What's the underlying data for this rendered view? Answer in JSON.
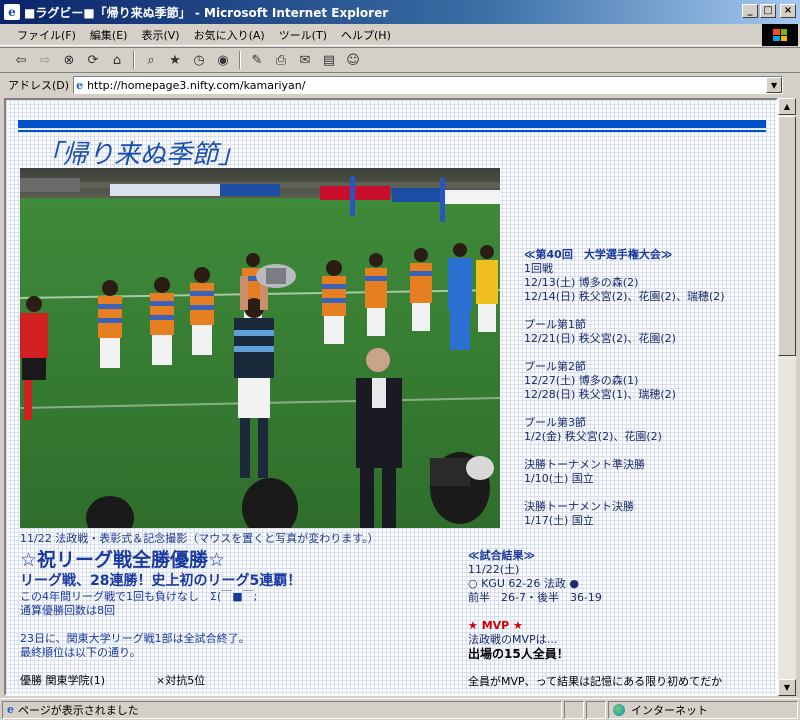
{
  "window": {
    "title": "■ラグビー■「帰り来ぬ季節」 - Microsoft Internet Explorer",
    "buttons": [
      "_",
      "□",
      "×"
    ]
  },
  "menu": [
    "ファイル(F)",
    "編集(E)",
    "表示(V)",
    "お気に入り(A)",
    "ツール(T)",
    "ヘルプ(H)"
  ],
  "toolbar_icons": [
    "back-icon",
    "forward-icon",
    "stop-icon",
    "refresh-icon",
    "home-icon",
    "search-icon",
    "favorites-icon",
    "history-icon",
    "media-icon",
    "edit-icon",
    "print-icon",
    "mail-icon",
    "discuss-icon",
    "messenger-icon"
  ],
  "address": {
    "label": "アドレス(D)",
    "url": "http://homepage3.nifty.com/kamariyan/"
  },
  "page": {
    "title": "「帰り来ぬ季節」",
    "photo_caption": "11/22 法政戦・表彰式＆記念撮影（マウスを置くと写真が変わります。）",
    "schedule": {
      "heading": "≪第40回　大学選手権大会≫",
      "lines": [
        "1回戦",
        "12/13(土) 博多の森(2)",
        "12/14(日) 秩父宮(2)、花園(2)、瑞穂(2)",
        "",
        "プール第1節",
        "12/21(日) 秩父宮(2)、花園(2)",
        "",
        "プール第2節",
        "12/27(土) 博多の森(1)",
        "12/28(日) 秩父宮(1)、瑞穂(2)",
        "",
        "プール第3節",
        "1/2(金) 秩父宮(2)、花園(2)",
        "",
        "決勝トーナメント準決勝",
        "1/10(土) 国立",
        "",
        "決勝トーナメント決勝",
        "1/17(土) 国立"
      ]
    },
    "headline": "☆祝リーグ戦全勝優勝☆",
    "subheadline": "リーグ戦、28連勝！史上初のリーグ5連覇！",
    "body_lines": [
      "この4年間リーグ戦で1回も負けなし　Σ(￣■￣;",
      "通算優勝回数は8回",
      "",
      "23日に、関東大学リーグ戦1部は全試合終了。",
      "最終順位は以下の通り。",
      ""
    ],
    "standings": [
      {
        "left": "優勝 関東学院(1)",
        "right": "×対抗5位"
      }
    ],
    "result": {
      "heading": "≪試合結果≫",
      "date": "11/22(土)",
      "score": "○ KGU 62-26 法政 ●",
      "halves": "前半　26-7・後半　36-19"
    },
    "mvp": {
      "heading": "★ MVP ★",
      "line1": "法政戦のMVPは…",
      "line2": "出場の15人全員！",
      "line3": "全員がMVP、って結果は記憶にある限り初めてだか"
    }
  },
  "status": {
    "text": "ページが表示されました",
    "zone": "インターネット"
  },
  "colors": {
    "accent": "#0050c8",
    "title_text": "#1a4fb0",
    "mvp": "#d00000"
  }
}
